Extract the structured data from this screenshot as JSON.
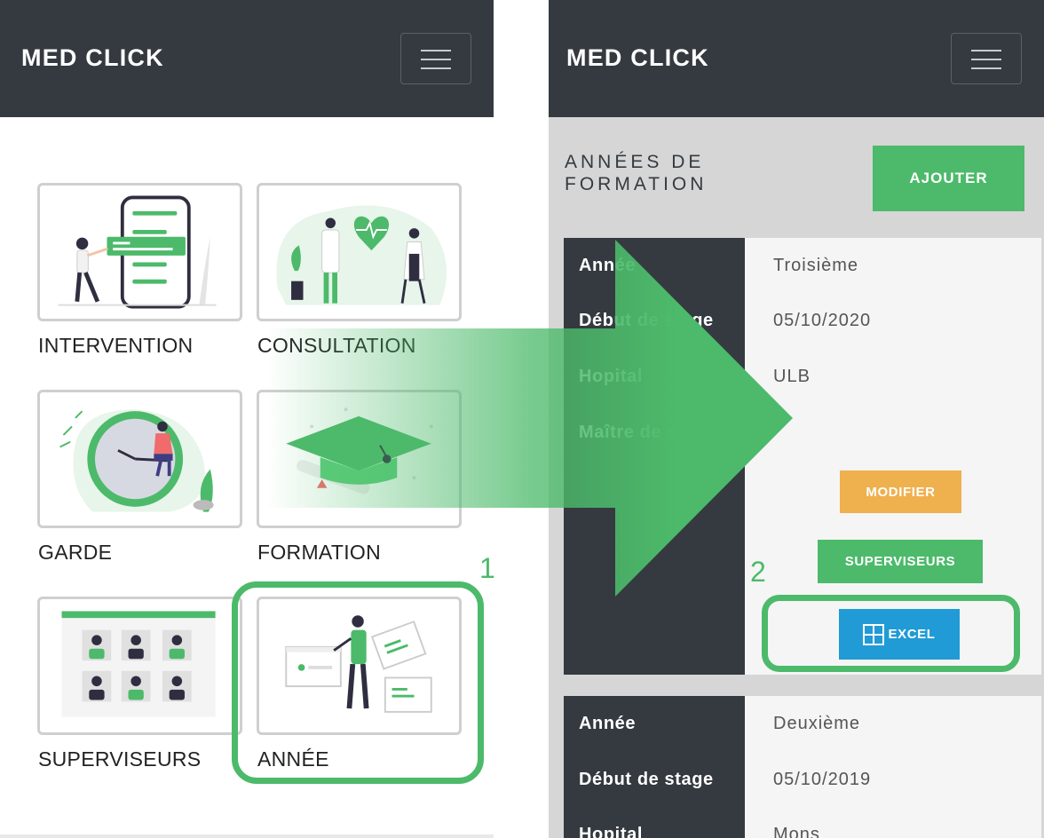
{
  "left_screen": {
    "brand": "MED CLICK",
    "tiles": [
      {
        "label": "INTERVENTION",
        "icon": "phone-list-illustration"
      },
      {
        "label": "CONSULTATION",
        "icon": "doctors-heart-illustration"
      },
      {
        "label": "GARDE",
        "icon": "clock-illustration"
      },
      {
        "label": "FORMATION",
        "icon": "graduation-cap-illustration"
      },
      {
        "label": "SUPERVISEURS",
        "icon": "people-grid-illustration"
      },
      {
        "label": "ANNÉE",
        "icon": "person-windows-illustration"
      }
    ]
  },
  "right_screen": {
    "brand": "MED CLICK",
    "section_title": "ANNÉES DE FORMATION",
    "add_button": "AJOUTER",
    "records": [
      {
        "fields": [
          {
            "label": "Année",
            "value": "Troisième"
          },
          {
            "label": "Début de stage",
            "value": "05/10/2020"
          },
          {
            "label": "Hopital",
            "value": "ULB"
          },
          {
            "label": "Maître de stage",
            "value": ""
          }
        ],
        "buttons": {
          "modify": "MODIFIER",
          "supervisors": "SUPERVISEURS",
          "excel": "EXCEL"
        }
      },
      {
        "fields": [
          {
            "label": "Année",
            "value": "Deuxième"
          },
          {
            "label": "Début de stage",
            "value": "05/10/2019"
          },
          {
            "label": "Hopital",
            "value": "Mons"
          }
        ]
      }
    ]
  },
  "annotations": {
    "step_1": "1",
    "step_2": "2"
  },
  "colors": {
    "navbar": "#343a40",
    "accent_green": "#4cba6a",
    "modify_orange": "#efb04e",
    "excel_blue": "#209bd5",
    "tile_border": "#cfcfcf"
  }
}
